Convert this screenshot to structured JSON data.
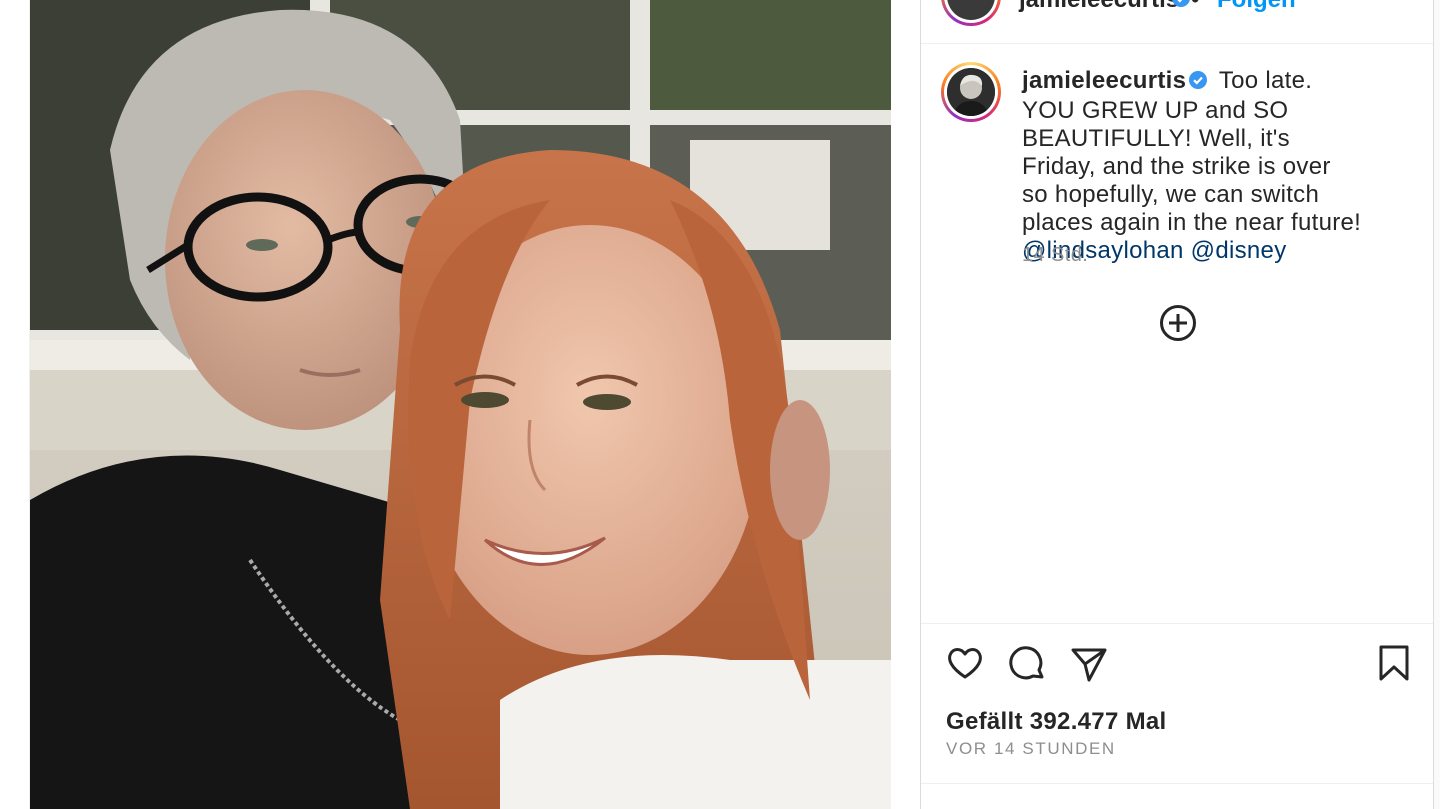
{
  "header": {
    "username": "jamieleecurtis",
    "follow_label": "Folgen",
    "dot": "•"
  },
  "caption": {
    "username": "jamieleecurtis",
    "text": "Too late. YOU GREW UP and SO BEAUTIFULLY! Well, it's Friday, and the strike is over so hopefully, we can switch places again in the near future!",
    "mention_1": "@lindsaylohan",
    "mention_2": "@disney",
    "timestamp": "14 Std."
  },
  "actions": {
    "likes": "Gefällt 392.477 Mal",
    "post_age": "VOR 14 STUNDEN"
  },
  "icons": {
    "verified": "verified-badge-icon",
    "like": "heart-icon",
    "comment": "comment-bubble-icon",
    "share": "paper-plane-icon",
    "save": "bookmark-icon",
    "more_comments": "plus-circle-icon"
  },
  "colors": {
    "follow_blue": "#0095f6",
    "verified_blue": "#3897f0",
    "mention_blue": "#00376b",
    "muted_text": "#8e8e8e",
    "text": "#262626",
    "border": "#dbdbdb"
  }
}
